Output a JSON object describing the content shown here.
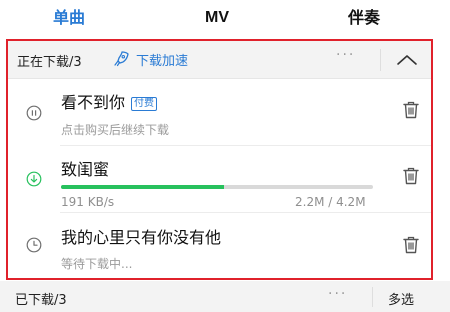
{
  "tabs": [
    {
      "label": "单曲",
      "active": true
    },
    {
      "label": "MV",
      "active": false
    },
    {
      "label": "伴奏",
      "active": false
    }
  ],
  "downloading": {
    "title": "正在下载/3",
    "speed_up_label": "下载加速",
    "more_label": "···",
    "items": [
      {
        "title": "看不到你",
        "badge": "付费",
        "status": "点击购买后继续下载",
        "icon": "pause-icon"
      },
      {
        "title": "致闺蜜",
        "speed": "191 KB/s",
        "size": "2.2M / 4.2M",
        "progress": 0.524,
        "icon": "download-icon"
      },
      {
        "title": "我的心里只有你没有他",
        "status": "等待下载中...",
        "icon": "clock-icon"
      }
    ]
  },
  "downloaded": {
    "title": "已下载/3",
    "more_label": "···",
    "multi_select_label": "多选"
  },
  "colors": {
    "accent": "#2a7bd4",
    "progress": "#27c15d",
    "highlight_border": "#e0212b"
  }
}
